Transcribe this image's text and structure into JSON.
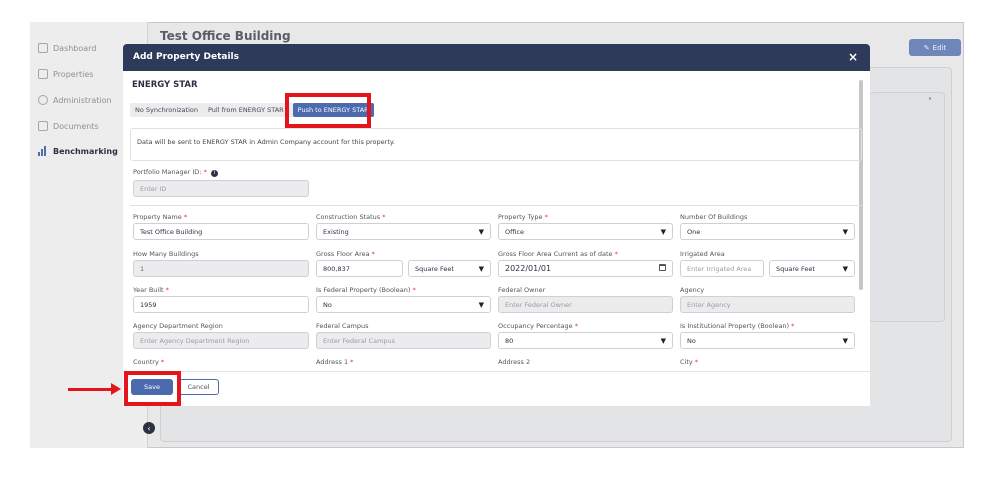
{
  "background": {
    "page_title": "Test Office Building",
    "edit_label": "Edit"
  },
  "sidebar": {
    "items": [
      {
        "label": "Dashboard",
        "icon": "dashboard-icon"
      },
      {
        "label": "Properties",
        "icon": "properties-icon"
      },
      {
        "label": "Administration",
        "icon": "administration-icon"
      },
      {
        "label": "Documents",
        "icon": "documents-icon"
      },
      {
        "label": "Benchmarking",
        "icon": "benchmarking-icon"
      }
    ],
    "active": "Benchmarking"
  },
  "modal": {
    "title": "Add Property Details",
    "close_label": "×",
    "section_title": "ENERGY STAR",
    "tabs": [
      {
        "label": "No Synchronization"
      },
      {
        "label": "Pull from ENERGY STAR"
      },
      {
        "label": "Push to ENERGY STAR"
      }
    ],
    "active_tab": "Push to ENERGY STAR",
    "info_text": "Data will be sent to ENERGY STAR in Admin Company account for this property.",
    "portfolio_manager": {
      "label": "Portfolio Manager ID:",
      "placeholder": "Enter ID"
    },
    "fields": {
      "property_name": {
        "label": "Property Name",
        "value": "Test Office Building"
      },
      "construction_status": {
        "label": "Construction Status",
        "value": "Existing"
      },
      "property_type": {
        "label": "Property Type",
        "value": "Office"
      },
      "number_of_buildings": {
        "label": "Number Of Buildings",
        "value": "One"
      },
      "how_many_buildings": {
        "label": "How Many Buildings",
        "value": "1"
      },
      "gross_floor_area": {
        "label": "Gross Floor Area",
        "value": "800,837",
        "unit": "Square Feet"
      },
      "gfa_current_date": {
        "label": "Gross Floor Area Current as of date",
        "value": "2022/01/01"
      },
      "irrigated_area": {
        "label": "Irrigated Area",
        "placeholder": "Enter Irrigated Area",
        "unit": "Square Feet"
      },
      "year_built": {
        "label": "Year Built",
        "value": "1959"
      },
      "is_federal_property": {
        "label": "Is Federal Property (Boolean)",
        "value": "No"
      },
      "federal_owner": {
        "label": "Federal Owner",
        "placeholder": "Enter Federal Owner"
      },
      "agency": {
        "label": "Agency",
        "placeholder": "Enter Agency"
      },
      "agency_department_region": {
        "label": "Agency Department Region",
        "placeholder": "Enter Agency Department Region"
      },
      "federal_campus": {
        "label": "Federal Campus",
        "placeholder": "Enter Federal Campus"
      },
      "occupancy_percentage": {
        "label": "Occupancy Percentage",
        "value": "80"
      },
      "is_institutional_property": {
        "label": "Is Institutional Property (Boolean)",
        "value": "No"
      },
      "country": {
        "label": "Country"
      },
      "address1": {
        "label": "Address 1"
      },
      "address2": {
        "label": "Address 2"
      },
      "city": {
        "label": "City"
      }
    },
    "required_mark": "*",
    "save_label": "Save",
    "cancel_label": "Cancel"
  },
  "annotations": {
    "highlight_color": "#e3141c"
  }
}
